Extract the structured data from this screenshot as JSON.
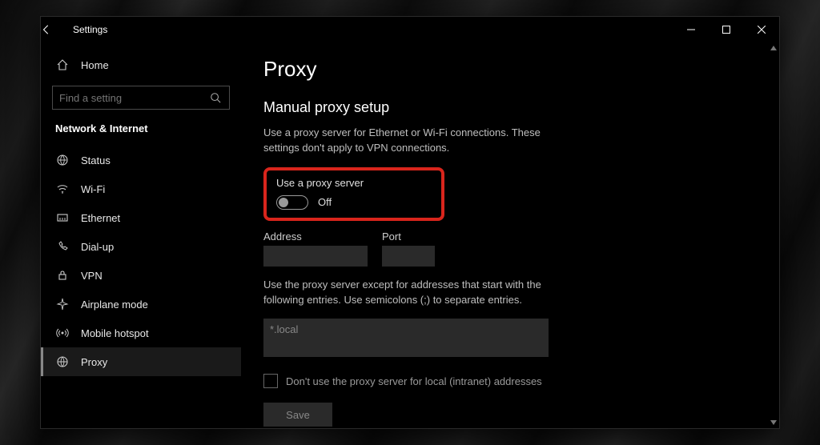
{
  "titlebar": {
    "title": "Settings"
  },
  "sidebar": {
    "home_label": "Home",
    "search_placeholder": "Find a setting",
    "category": "Network & Internet",
    "items": [
      {
        "label": "Status",
        "icon": "status-icon"
      },
      {
        "label": "Wi-Fi",
        "icon": "wifi-icon"
      },
      {
        "label": "Ethernet",
        "icon": "ethernet-icon"
      },
      {
        "label": "Dial-up",
        "icon": "dialup-icon"
      },
      {
        "label": "VPN",
        "icon": "vpn-icon"
      },
      {
        "label": "Airplane mode",
        "icon": "airplane-icon"
      },
      {
        "label": "Mobile hotspot",
        "icon": "hotspot-icon"
      },
      {
        "label": "Proxy",
        "icon": "globe-icon"
      }
    ]
  },
  "main": {
    "page_title": "Proxy",
    "section_title": "Manual proxy setup",
    "description": "Use a proxy server for Ethernet or Wi-Fi connections. These settings don't apply to VPN connections.",
    "toggle_label": "Use a proxy server",
    "toggle_state": "Off",
    "address_label": "Address",
    "address_value": "",
    "port_label": "Port",
    "port_value": "",
    "exceptions_desc": "Use the proxy server except for addresses that start with the following entries. Use semicolons (;) to separate entries.",
    "exceptions_value": "*.local",
    "local_checkbox_label": "Don't use the proxy server for local (intranet) addresses",
    "save_label": "Save"
  },
  "colors": {
    "highlight": "#d9251c"
  }
}
